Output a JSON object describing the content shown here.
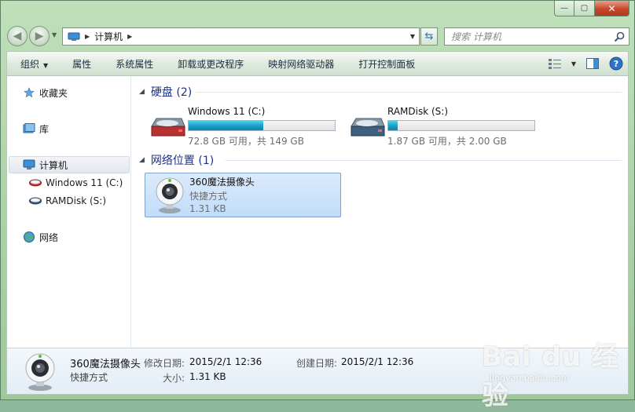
{
  "window": {
    "caption_buttons": {
      "minimize": "—",
      "maximize": "▢",
      "close": "✕"
    }
  },
  "nav": {
    "address_path": "计算机",
    "search_placeholder": "搜索 计算机"
  },
  "toolbar": {
    "organize": "组织",
    "properties": "属性",
    "system_properties": "系统属性",
    "uninstall": "卸载或更改程序",
    "map_drive": "映射网络驱动器",
    "control_panel": "打开控制面板"
  },
  "sidebar": {
    "favorites": "收藏夹",
    "libraries": "库",
    "computer": "计算机",
    "drive_c": "Windows 11 (C:)",
    "drive_s": "RAMDisk (S:)",
    "network": "网络"
  },
  "groups": {
    "hard_disks": "硬盘 (2)",
    "network_locations": "网络位置 (1)"
  },
  "drives": [
    {
      "name": "Windows 11 (C:)",
      "free_text": "72.8 GB 可用，共 149 GB",
      "used_fraction": 0.51
    },
    {
      "name": "RAMDisk (S:)",
      "free_text": "1.87 GB 可用，共 2.00 GB",
      "used_fraction": 0.065
    }
  ],
  "network_item": {
    "name": "360魔法摄像头",
    "type": "快捷方式",
    "size": "1.31 KB"
  },
  "details": {
    "name": "360魔法摄像头",
    "type": "快捷方式",
    "modified_label": "修改日期:",
    "modified_value": "2015/2/1 12:36",
    "created_label": "创建日期:",
    "created_value": "2015/2/1 12:36",
    "size_label": "大小:",
    "size_value": "1.31 KB"
  },
  "watermark": {
    "main": "Bai du 经验",
    "sub": "jingyan.baidu.com"
  },
  "colors": {
    "group_header": "#1e3287",
    "bar_fill": "#1ba1c7",
    "selection": "#c1dcfa"
  }
}
